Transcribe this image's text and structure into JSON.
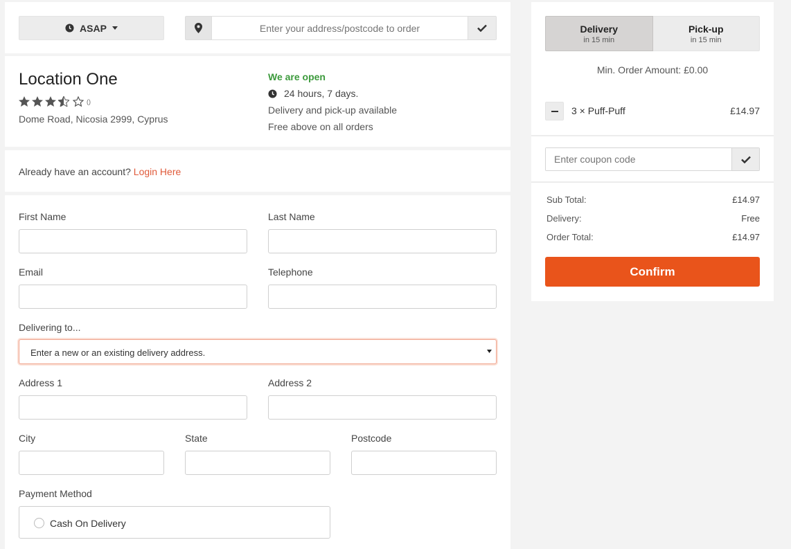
{
  "topbar": {
    "time_button": "ASAP",
    "address_placeholder": "Enter your address/postcode to order"
  },
  "location": {
    "name": "Location One",
    "rating": 3.5,
    "review_count": "()",
    "address": "Dome Road, Nicosia 2999, Cyprus",
    "status": "We are open",
    "hours": "24 hours, 7 days.",
    "services": "Delivery and pick-up available",
    "free_note": "Free above on all orders"
  },
  "account": {
    "prompt": "Already have an account?",
    "login_link": "Login Here"
  },
  "form": {
    "first_name_label": "First Name",
    "last_name_label": "Last Name",
    "email_label": "Email",
    "telephone_label": "Telephone",
    "delivering_label": "Delivering to...",
    "delivering_select": "Enter a new or an existing delivery address.",
    "address1_label": "Address 1",
    "address2_label": "Address 2",
    "city_label": "City",
    "state_label": "State",
    "postcode_label": "Postcode",
    "payment_label": "Payment Method",
    "payment_option": "Cash On Delivery"
  },
  "cart": {
    "delivery_tab": {
      "title": "Delivery",
      "sub": "in 15 min"
    },
    "pickup_tab": {
      "title": "Pick-up",
      "sub": "in 15 min"
    },
    "min_order": "Min. Order Amount: £0.00",
    "item": {
      "qty": "3 ×",
      "name": "Puff-Puff",
      "price": "£14.97"
    },
    "coupon_placeholder": "Enter coupon code",
    "subtotal_label": "Sub Total:",
    "subtotal_value": "£14.97",
    "delivery_label": "Delivery:",
    "delivery_value": "Free",
    "total_label": "Order Total:",
    "total_value": "£14.97",
    "confirm": "Confirm"
  },
  "colors": {
    "accent": "#e9541b",
    "open_green": "#3c9a3c",
    "login_link": "#e05a3a"
  }
}
